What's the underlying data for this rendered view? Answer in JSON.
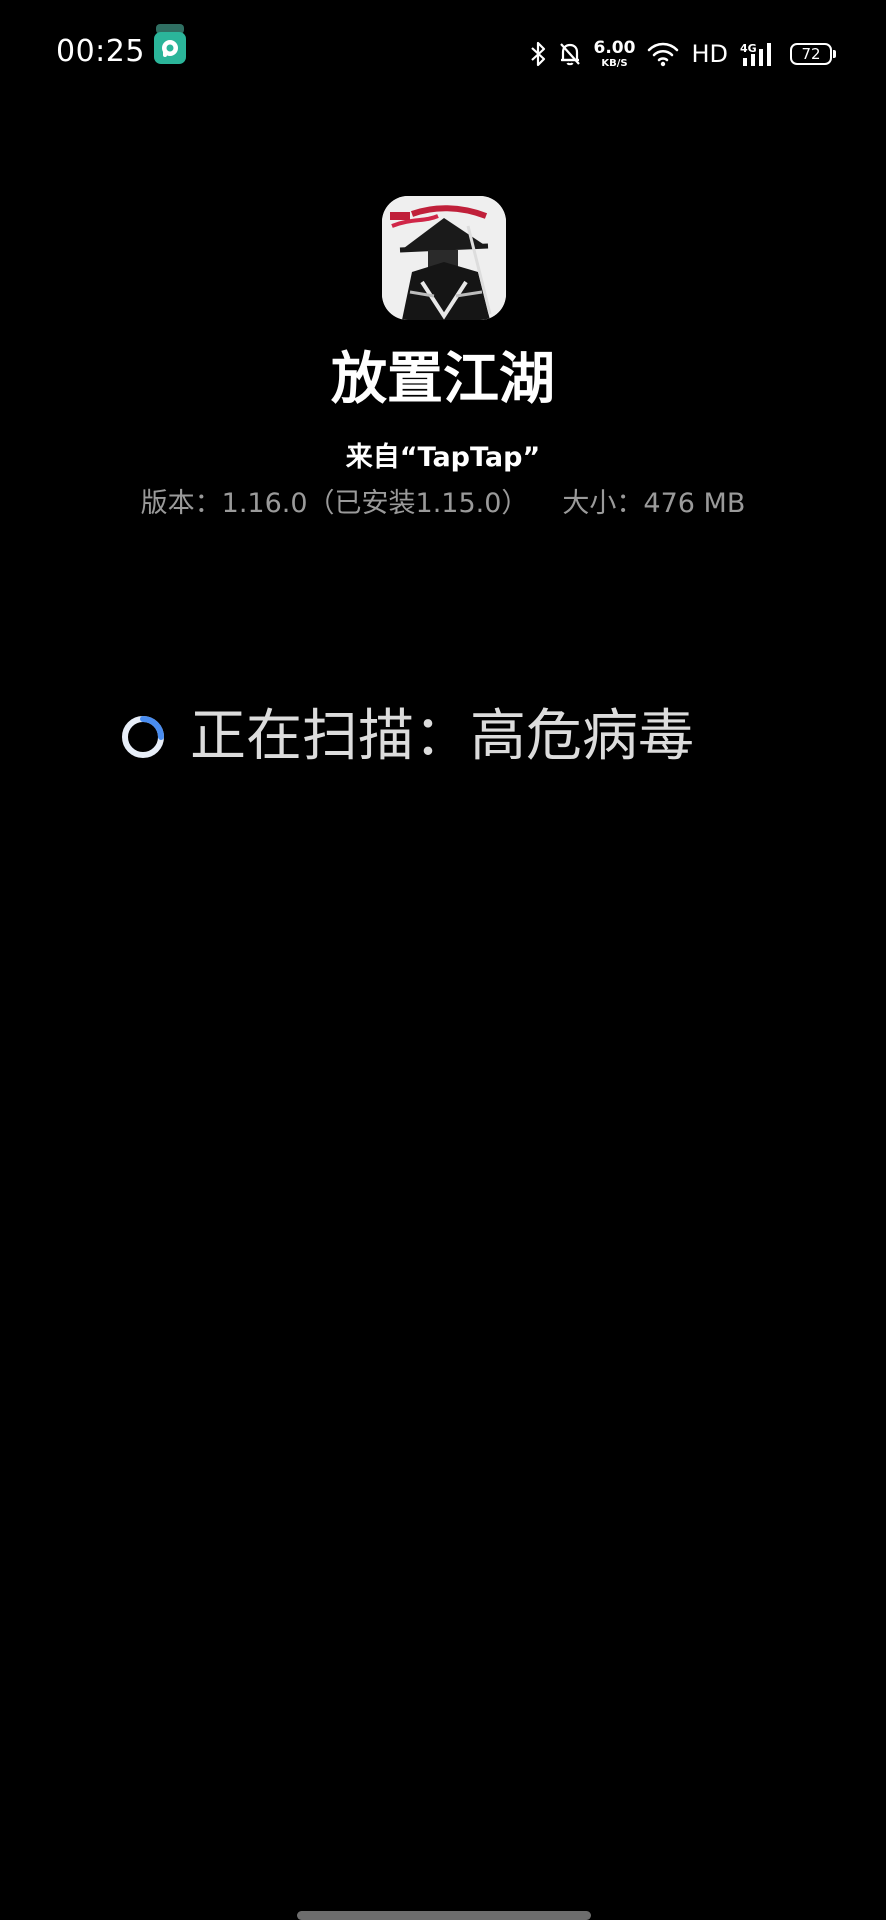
{
  "status_bar": {
    "time": "00:25",
    "net_speed_value": "6.00",
    "net_speed_unit": "KB/S",
    "network_label": "HD",
    "signal_type": "4G",
    "battery_level": "72",
    "icons": [
      "notification-app-icon",
      "bluetooth-icon",
      "bell-muted-icon",
      "wifi-icon",
      "cellular-signal-icon",
      "battery-icon"
    ]
  },
  "app": {
    "name": "放置江湖",
    "source": "来自“TapTap”",
    "version": "版本：1.16.0（已安装1.15.0）",
    "size": "大小：476 MB"
  },
  "scan": {
    "status_text": "正在扫描：高危病毒"
  },
  "colors": {
    "background": "#000000",
    "primary_text": "#ffffff",
    "secondary_text": "#9a9a9a",
    "spinner_accent": "#4a8df0",
    "notif_icon": "#2bb59a"
  }
}
